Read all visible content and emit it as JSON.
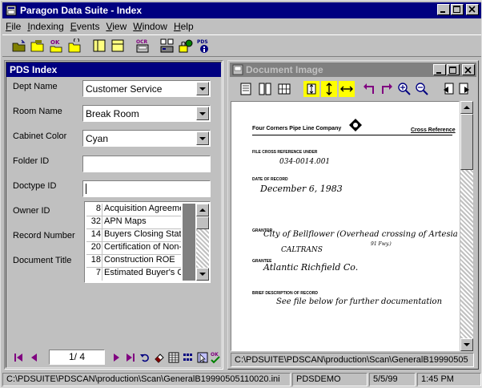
{
  "window": {
    "title": "Paragon Data Suite  -  Index",
    "controls": [
      "minimize-icon",
      "maximize-icon",
      "close-icon"
    ]
  },
  "menu": {
    "items": [
      {
        "label": "File",
        "underline": "F"
      },
      {
        "label": "Indexing",
        "underline": "I"
      },
      {
        "label": "Events",
        "underline": "E"
      },
      {
        "label": "View",
        "underline": "V"
      },
      {
        "label": "Window",
        "underline": "W"
      },
      {
        "label": "Help",
        "underline": "H"
      }
    ]
  },
  "toolbar": {
    "icons": [
      "open-folder-icon",
      "folder-icon",
      "ok-check-icon",
      "folder-refresh-icon",
      "split-vertical-icon",
      "split-horizontal-icon",
      "ocr-icon",
      "scan-icon",
      "lock-user-icon",
      "pds-info-icon"
    ],
    "labels": {
      "ok": "OK",
      "ocr": "OCR",
      "pds": "PDS"
    }
  },
  "index_panel": {
    "title": "PDS Index",
    "fields": {
      "dept_name": {
        "label": "Dept Name",
        "value": "Customer Service"
      },
      "room_name": {
        "label": "Room Name",
        "value": "Break Room"
      },
      "cabinet_color": {
        "label": "Cabinet Color",
        "value": "Cyan"
      },
      "folder_id": {
        "label": "Folder ID",
        "value": ""
      },
      "doctype_id": {
        "label": "Doctype ID",
        "value": ""
      },
      "owner_id": {
        "label": "Owner ID"
      },
      "record_number": {
        "label": "Record Number"
      },
      "document_title": {
        "label": "Document Title"
      }
    },
    "doc_list": [
      {
        "num": "8",
        "title": "Acquisition Agreeme"
      },
      {
        "num": "32",
        "title": "APN Maps"
      },
      {
        "num": "14",
        "title": "Buyers Closing State"
      },
      {
        "num": "20",
        "title": "Certification of Non-"
      },
      {
        "num": "18",
        "title": "Construction ROE"
      },
      {
        "num": "7",
        "title": "Estimated Buyer's C"
      }
    ],
    "pager": {
      "value": "1/ 4"
    },
    "ok_label": "OK"
  },
  "document_window": {
    "title": "Document Image",
    "image_path": "C:\\PDSUITE\\PDSCAN\\production\\Scan\\GeneralB19990505",
    "scan": {
      "company": "Four Corners Pipe Line Company",
      "cross_ref": "Cross Reference",
      "file_label": "FILE CROSS REFERENCE UNDER",
      "file_value": "034-0014.001",
      "date_label": "DATE OF RECORD",
      "date_value": "December 6, 1983",
      "grantor_label": "GRANTOR",
      "grantor_value": "City of Bellflower (Overhead crossing of Artesia",
      "grantor_note": "91 Fwy.)",
      "grantor_extra": "CALTRANS",
      "grantee_label": "GRANTEE",
      "grantee_value": "Atlantic Richfield Co.",
      "desc_label": "BRIEF DESCRIPTION OF RECORD",
      "desc_value": "See file below for further documentation"
    }
  },
  "status": {
    "path": "C:\\PDSUITE\\PDSCAN\\production\\Scan\\GeneralB19990505110020.ini",
    "user": "PDSDEMO",
    "date": "5/5/99",
    "time": "1:45 PM"
  },
  "colors": {
    "title_active": "#000080",
    "title_inactive": "#808080",
    "face": "#c0c0c0",
    "highlight_tool": "#ffff00"
  }
}
